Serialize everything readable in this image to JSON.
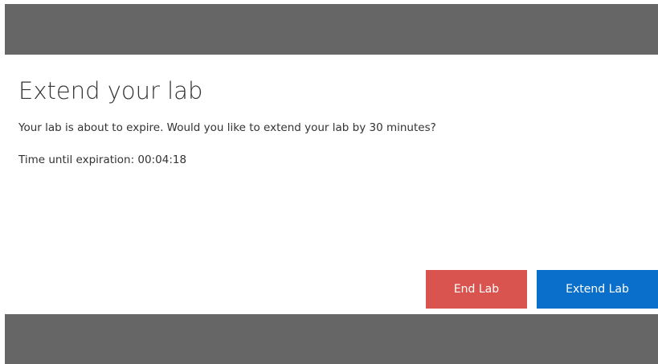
{
  "dialog": {
    "title": "Extend your lab",
    "message": "Your lab is about to expire. Would you like to extend your lab by 30 minutes?",
    "timer_text": "Time until expiration: 00:04:18"
  },
  "buttons": {
    "end_label": "End Lab",
    "extend_label": "Extend Lab"
  },
  "colors": {
    "overlay": "#666666",
    "end_button": "#d9534f",
    "extend_button": "#0a6fcb"
  }
}
